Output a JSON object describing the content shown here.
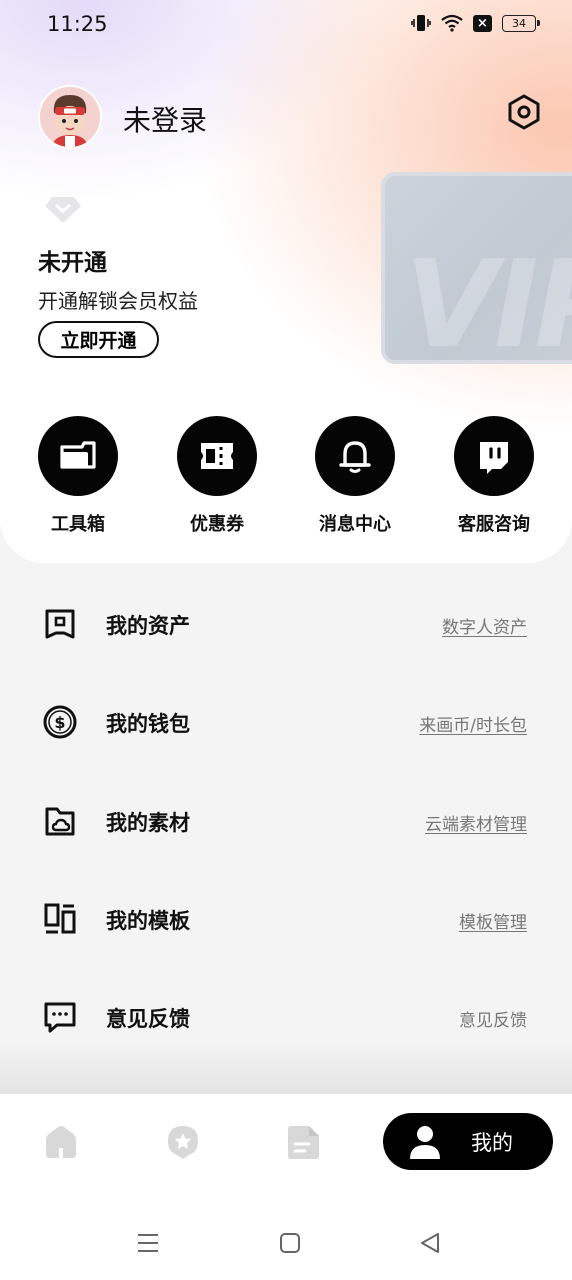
{
  "status_bar": {
    "time": "11:25",
    "battery": "34"
  },
  "profile": {
    "username": "未登录"
  },
  "vip": {
    "status": "未开通",
    "description": "开通解锁会员权益",
    "open_button": "立即开通",
    "card_text": "VIP"
  },
  "quick_actions": [
    {
      "label": "工具箱",
      "icon": "toolbox-icon"
    },
    {
      "label": "优惠券",
      "icon": "coupon-icon"
    },
    {
      "label": "消息中心",
      "icon": "bell-icon"
    },
    {
      "label": "客服咨询",
      "icon": "chat-icon"
    }
  ],
  "menu": [
    {
      "title": "我的资产",
      "link": "数字人资产",
      "icon": "asset-icon"
    },
    {
      "title": "我的钱包",
      "link": "来画币/时长包",
      "icon": "wallet-icon"
    },
    {
      "title": "我的素材",
      "link": "云端素材管理",
      "icon": "folder-cloud-icon"
    },
    {
      "title": "我的模板",
      "link": "模板管理",
      "icon": "template-icon"
    },
    {
      "title": "意见反馈",
      "link": "意见反馈",
      "icon": "feedback-icon"
    }
  ],
  "bottom_nav": {
    "items": [
      "home-icon",
      "discover-icon",
      "document-icon"
    ],
    "active_label": "我的"
  },
  "colors": {
    "accent": "#000000",
    "background": "#f4f4f4",
    "link": "#777777"
  }
}
